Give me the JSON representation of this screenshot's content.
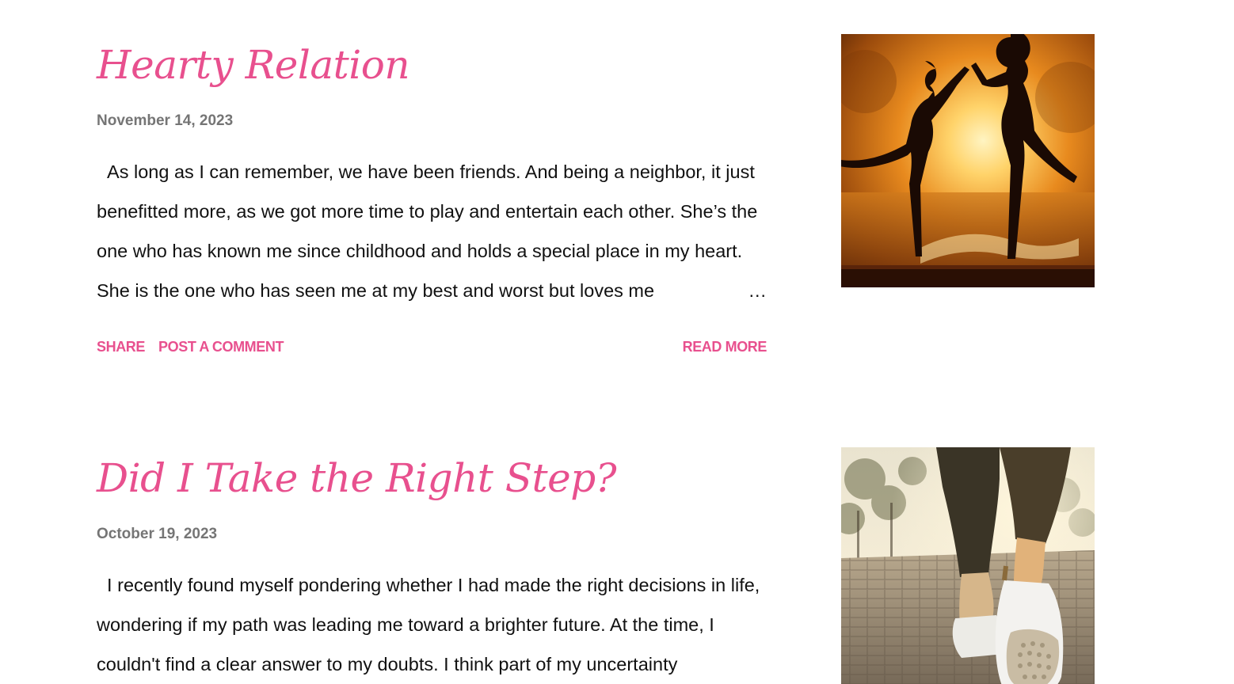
{
  "posts": [
    {
      "title": "Hearty Relation",
      "date": "November 14, 2023",
      "snippet": "As long as I can remember, we have been friends. And being a neighbor, it just benefitted more, as we got more time to play and entertain each other. She’s the one who has known me since childhood and holds a special place in my heart. She is the one who has seen me at my best and worst but loves me",
      "ellipsis": "…",
      "actions": {
        "share": "SHARE",
        "comment": "POST A COMMENT",
        "read_more": "READ MORE"
      },
      "thumbnail": "two-friends-silhouette-sunset-image"
    },
    {
      "title": "Did I Take the Right Step?",
      "date": "October 19, 2023",
      "snippet": "I recently found myself pondering whether I had made the right decisions in life, wondering if my path was leading me toward a brighter future. At the time, I couldn't find a clear answer to my doubts. I think part of my uncertainty",
      "thumbnail": "walking-feet-sneakers-image"
    }
  ],
  "colors": {
    "accent": "#e8508e",
    "date": "#757575",
    "text": "#111111"
  }
}
